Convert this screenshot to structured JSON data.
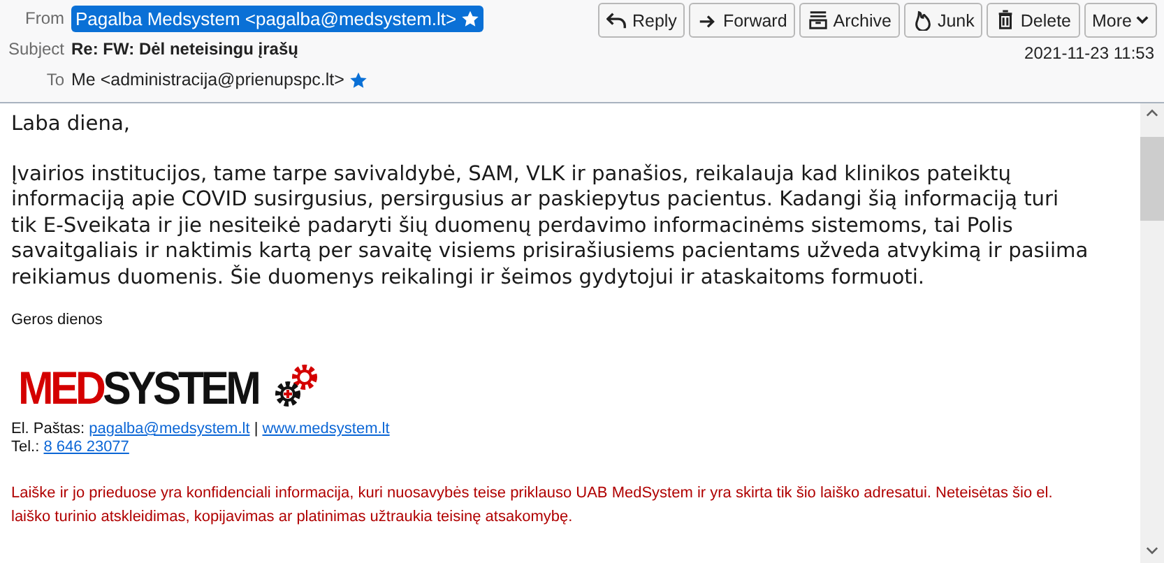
{
  "header": {
    "from_label": "From",
    "from": "Pagalba Medsystem <pagalba@medsystem.lt>",
    "from_starred": true,
    "subject_label": "Subject",
    "subject": "Re: FW: Dėl neteisingu įrašų",
    "to_label": "To",
    "to": "Me <administracija@prienupspc.lt>",
    "to_starred": true,
    "date": "2021-11-23 11:53"
  },
  "toolbar": [
    {
      "kind": "reply",
      "label": "Reply"
    },
    {
      "kind": "forward",
      "label": "Forward"
    },
    {
      "kind": "archive",
      "label": "Archive"
    },
    {
      "kind": "junk",
      "label": "Junk"
    },
    {
      "kind": "delete",
      "label": "Delete"
    },
    {
      "kind": "more",
      "label": "More"
    }
  ],
  "body": {
    "greeting": "Laba diena,",
    "paragraph_lines": [
      "Įvairios institucijos, tame tarpe savivaldybė, SAM, VLK ir panašios, reikalauja kad klinikos pateiktų",
      "informaciją apie COVID susirgusius, persirgusius ar paskiepytus pacientus. Kadangi šią informaciją turi",
      "tik E-Sveikata ir jie nesiteikė padaryti šių duomenų perdavimo informacinėms sistemoms, tai Polis",
      "savaitgaliais ir naktimis kartą per savaitę visiems prisirašiusiems pacientams užveda atvykimą ir pasiima",
      "reikiamus duomenis. Šie duomenys reikalingi ir šeimos gydytojui ir ataskaitoms formuoti."
    ],
    "closing": "Geros dienos",
    "logo": {
      "part_1": "MED",
      "part_2": "SYSTEM"
    },
    "email_label": "El. Paštas:",
    "email": "pagalba@medsystem.lt",
    "separator": "|",
    "website": "www.medsystem.lt",
    "phone_label": "Tel.:",
    "phone": "8 646 23077",
    "disclaimer_lines": [
      "Laiške ir jo prieduose yra konfidenciali informacija, kuri nuosavybės teise priklauso UAB MedSystem ir yra skirta tik šio laiško adresatui. Neteisėtas šio el.",
      "laiško turinio atskleidimas, kopijavimas ar platinimas užtraukia teisinę atsakomybę."
    ]
  }
}
